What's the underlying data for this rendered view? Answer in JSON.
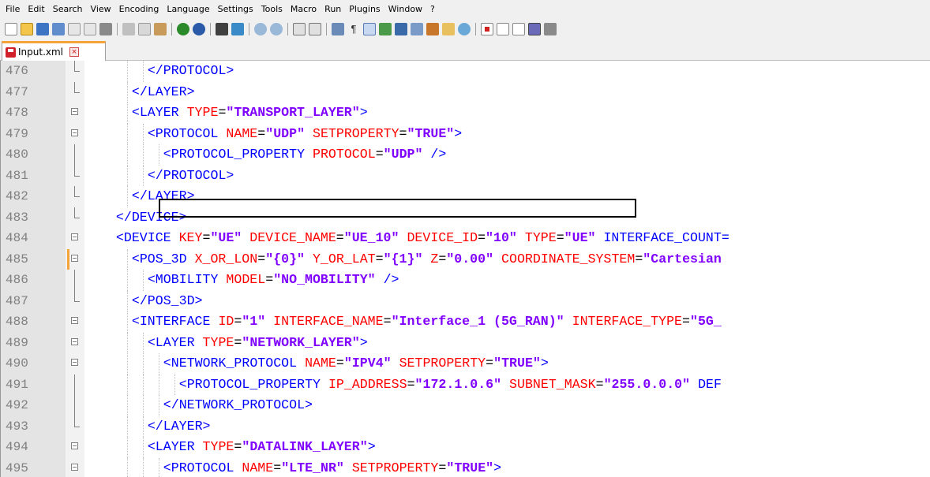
{
  "menu": [
    "File",
    "Edit",
    "Search",
    "View",
    "Encoding",
    "Language",
    "Settings",
    "Tools",
    "Macro",
    "Run",
    "Plugins",
    "Window",
    "?"
  ],
  "tab": {
    "label": "Input.xml",
    "close": "×"
  },
  "lines": [
    {
      "num": "476",
      "text": "</PROTOCOL>"
    },
    {
      "num": "477",
      "text": "</LAYER>"
    },
    {
      "num": "478",
      "text": "<LAYER TYPE=\"TRANSPORT_LAYER\">"
    },
    {
      "num": "479",
      "text": "<PROTOCOL NAME=\"UDP\" SETPROPERTY=\"TRUE\">"
    },
    {
      "num": "480",
      "text": "<PROTOCOL_PROPERTY PROTOCOL=\"UDP\" />"
    },
    {
      "num": "481",
      "text": "</PROTOCOL>"
    },
    {
      "num": "482",
      "text": "</LAYER>"
    },
    {
      "num": "483",
      "text": "</DEVICE>"
    },
    {
      "num": "484",
      "text": "<DEVICE KEY=\"UE\" DEVICE_NAME=\"UE_10\" DEVICE_ID=\"10\" TYPE=\"UE\" INTERFACE_COUNT="
    },
    {
      "num": "485",
      "text": "<POS_3D X_OR_LON=\"{0}\" Y_OR_LAT=\"{1}\" Z=\"0.00\" COORDINATE_SYSTEM=\"Cartesian"
    },
    {
      "num": "486",
      "text": "<MOBILITY MODEL=\"NO_MOBILITY\" />"
    },
    {
      "num": "487",
      "text": "</POS_3D>"
    },
    {
      "num": "488",
      "text": "<INTERFACE ID=\"1\" INTERFACE_NAME=\"Interface_1 (5G_RAN)\" INTERFACE_TYPE=\"5G_"
    },
    {
      "num": "489",
      "text": "<LAYER TYPE=\"NETWORK_LAYER\">"
    },
    {
      "num": "490",
      "text": "<NETWORK_PROTOCOL NAME=\"IPV4\" SETPROPERTY=\"TRUE\">"
    },
    {
      "num": "491",
      "text": "<PROTOCOL_PROPERTY IP_ADDRESS=\"172.1.0.6\" SUBNET_MASK=\"255.0.0.0\" DEF"
    },
    {
      "num": "492",
      "text": "</NETWORK_PROTOCOL>"
    },
    {
      "num": "493",
      "text": "</LAYER>"
    },
    {
      "num": "494",
      "text": "<LAYER TYPE=\"DATALINK_LAYER\">"
    },
    {
      "num": "495",
      "text": "<PROTOCOL NAME=\"LTE_NR\" SETPROPERTY=\"TRUE\">"
    }
  ],
  "colors": {
    "tag": "#0000ff",
    "attribute": "#ff0000",
    "value": "#8000ff",
    "line_number": "#808080",
    "tab_accent": "#f6a33a"
  },
  "highlighted_line": "485"
}
